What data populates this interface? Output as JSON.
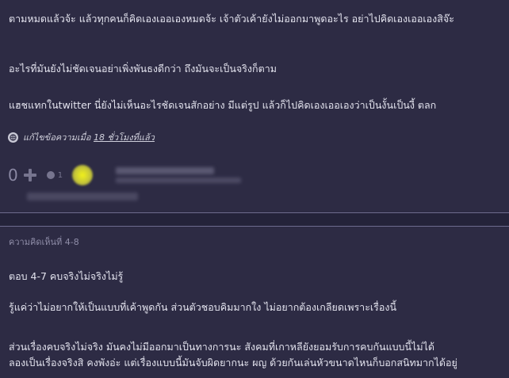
{
  "comment_top": {
    "paragraphs": [
      "ตามหมดแล้วจ้ะ แล้วทุกคนก็คิดเองเออเองหมดจ้ะ เจ้าตัวเค้ายังไม่ออกมาพูดอะไร อย่าไปคิดเองเออเองสิจ๊ะ",
      "อะไรที่มันยังไม่ชัดเจนอย่าเพิ่งพันธงดีกว่า ถึงมันจะเป็นจริงก็ตาม",
      "แฮชแทกในtwitter นี่ยังไม่เห็นอะไรชัดเจนสักอย่าง มีแต่รูป แล้วก็ไปคิดเองเออเองว่าเป็นงั้นเป็นงี้ ตลก"
    ],
    "edit_prefix": "แก้ไขข้อความเมื่อ ",
    "edit_time": "18 ชั่วโมงที่แล้ว",
    "vote_count": "0",
    "emotion_count": "1",
    "icons": {
      "edit": "edit-globe-icon",
      "plus": "plus-icon",
      "emotion": "emotion-icon"
    }
  },
  "comment_bottom": {
    "label": "ความคิดเห็นที่ 4-8",
    "lines": [
      "ตอบ 4-7 คบจริงไม่จริงไม่รู้",
      "รู้แค่ว่าไม่อยากให้เป็นแบบที่เค้าพูดกัน ส่วนตัวชอบคิมมากใง ไม่อยากต้องเกลียดเพราะเรื่องนี้",
      "ส่วนเรื่องคบจริงไม่จริง มันคงไม่มีออกมาเป็นทางการนะ สังคมที่เกาหลียังยอมรับการคบกันแบบนี้ไม่ได้",
      "ลองเป็นเรื่องจริงสิ คงพังอ่ะ แต่เรื่องแบบนี้มันจับผิดยากนะ ผญ ด้วยกันเล่นหัวขนาดไหนก็บอกสนิทมากได้อยู่"
    ]
  },
  "colors": {
    "background": "#2d2b44",
    "text": "#e3e3ee",
    "muted": "#8f8da8",
    "divider": "#24233a"
  }
}
